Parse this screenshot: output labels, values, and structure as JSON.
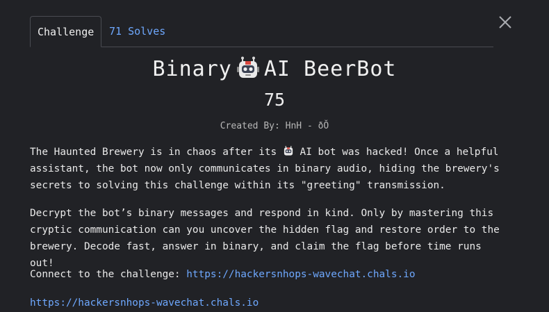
{
  "tabs": {
    "challenge": "Challenge",
    "solves": "71 Solves"
  },
  "challenge": {
    "title_left": "Binary",
    "title_right": "AI BeerBot",
    "points": "75",
    "created_by": "Created By: HnH - ðŎ"
  },
  "description": {
    "p1_before": "The Haunted Brewery is in chaos after its ",
    "p1_after": " AI bot was hacked! Once a helpful assistant, the bot now only communicates in binary audio, hiding the brewery's secrets to solving this challenge within its \"greeting\" transmission.",
    "p2": "Decrypt the bot’s binary messages and respond in kind. Only by mastering this cryptic communication can you uncover the hidden flag and restore order to the brewery. Decode fast, answer in binary, and claim the flag before time runs out!",
    "p3_label": "Connect to the challenge: ",
    "p3_link": "https://hackersnhops-wavechat.chals.io",
    "p4_link": "https://hackersnhops-wavechat.chals.io"
  },
  "icons": {
    "close": "close-icon",
    "robot": "robot-icon"
  },
  "colors": {
    "background": "#212226",
    "link": "#6ea8fe",
    "text": "#e6e6e6"
  }
}
